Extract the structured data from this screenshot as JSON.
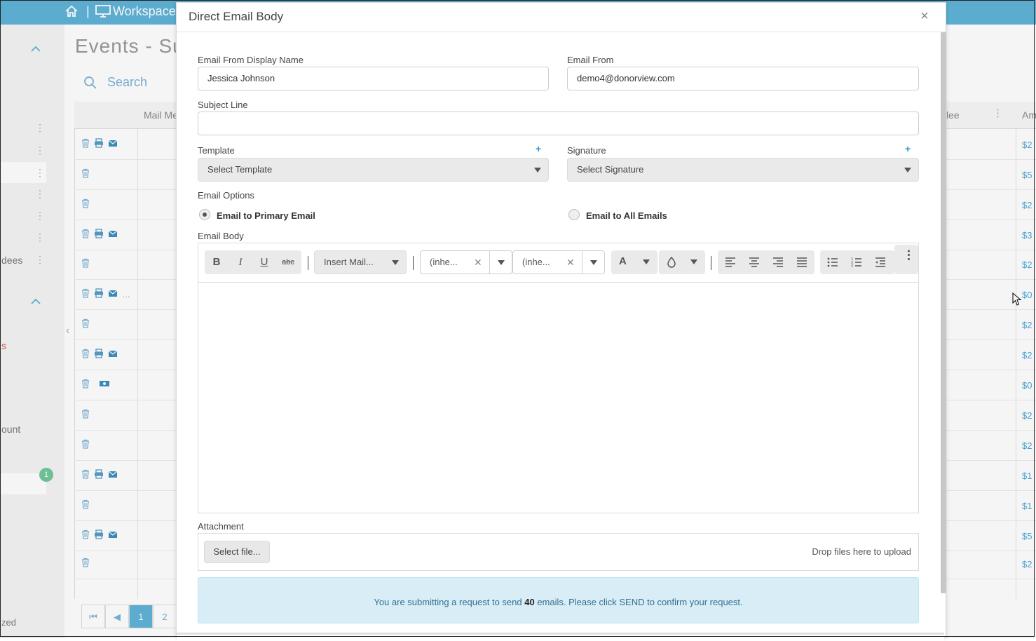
{
  "topbar": {
    "sep": "|",
    "workspace_label": "Workspace"
  },
  "page": {
    "title": "Events - Su",
    "search_placeholder": "Search",
    "grid_columns": [
      "Mail Me",
      "lee",
      "Am"
    ],
    "amounts": [
      "$2",
      "$5",
      "$2",
      "$3",
      "$2",
      "$0",
      "$2",
      "$2",
      "$0",
      "$2",
      "$2",
      "$1",
      "$1",
      "$5",
      "$2"
    ],
    "pager": {
      "page1": "1",
      "page2": "2"
    }
  },
  "leftnav": {
    "dees": "dees",
    "s": "s",
    "ount": "ount",
    "zed": "zed",
    "badge": "1"
  },
  "modal": {
    "title": "Direct Email Body",
    "close": "×",
    "from_name_label": "Email From Display Name",
    "from_name_value": "Jessica Johnson",
    "from_email_label": "Email From",
    "from_email_value": "demo4@donorview.com",
    "subject_label": "Subject Line",
    "subject_value": "",
    "template_label": "Template",
    "template_selected": "Select Template",
    "signature_label": "Signature",
    "signature_selected": "Select Signature",
    "plus": "+",
    "options_label": "Email Options",
    "opt_primary": "Email to Primary Email",
    "opt_all": "Email to All Emails",
    "body_label": "Email Body",
    "toolbar": {
      "bold": "B",
      "italic": "I",
      "underline": "U",
      "strike": "abc",
      "insert_mail": "Insert Mail...",
      "font_family": "(inhe...",
      "font_size": "(inhe...",
      "clear": "✕",
      "font_color": "A",
      "more": "⋮"
    },
    "attachment_label": "Attachment",
    "select_file": "Select file...",
    "drop_hint": "Drop files here to upload",
    "notice_pre": "You are submitting a request to send ",
    "notice_count": "40",
    "notice_post": " emails. Please click SEND to confirm your request."
  },
  "colors": {
    "accent": "#5fb4d8",
    "link": "#2c8fc7",
    "notice_bg": "#d9edf7"
  }
}
